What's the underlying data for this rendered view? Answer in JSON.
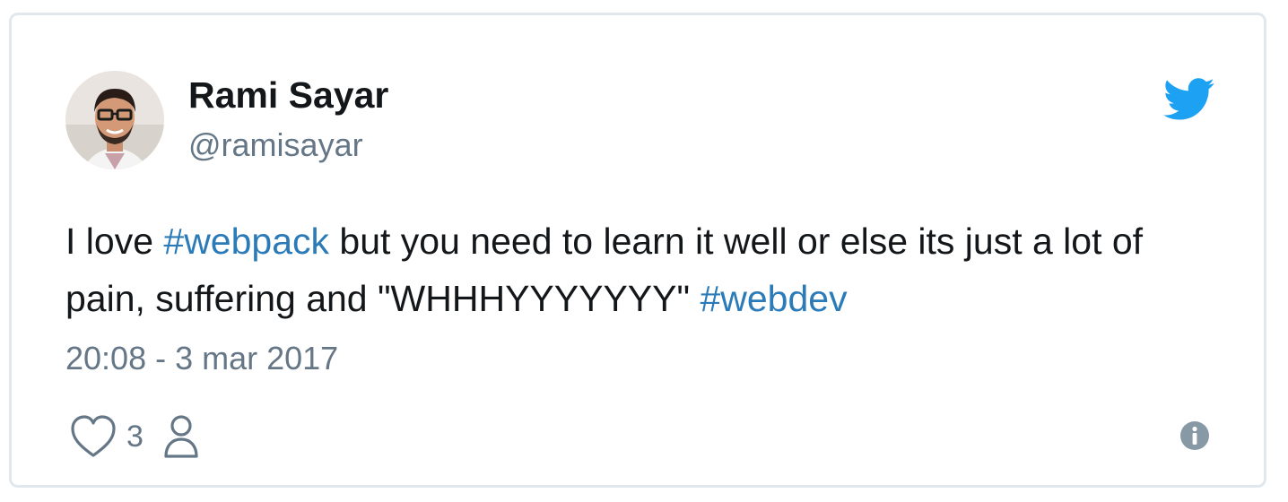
{
  "tweet": {
    "author_name": "Rami Sayar",
    "author_handle": "@ramisayar",
    "text_parts": [
      "I love ",
      "#webpack",
      " but you need to learn it well or else its just a lot of pain, suffering and \"WHHHYYYYYYY\" ",
      "#webdev"
    ],
    "timestamp": "20:08 - 3 mar 2017",
    "like_count": "3"
  },
  "icons": {
    "brand": "twitter-bird-icon",
    "like": "heart-icon",
    "user": "person-icon",
    "info": "info-icon"
  },
  "colors": {
    "brand_blue": "#1da1f2",
    "hashtag_blue": "#2b7bb9",
    "text_primary": "#14171a",
    "text_secondary": "#657786",
    "border": "#e1e8ed"
  }
}
